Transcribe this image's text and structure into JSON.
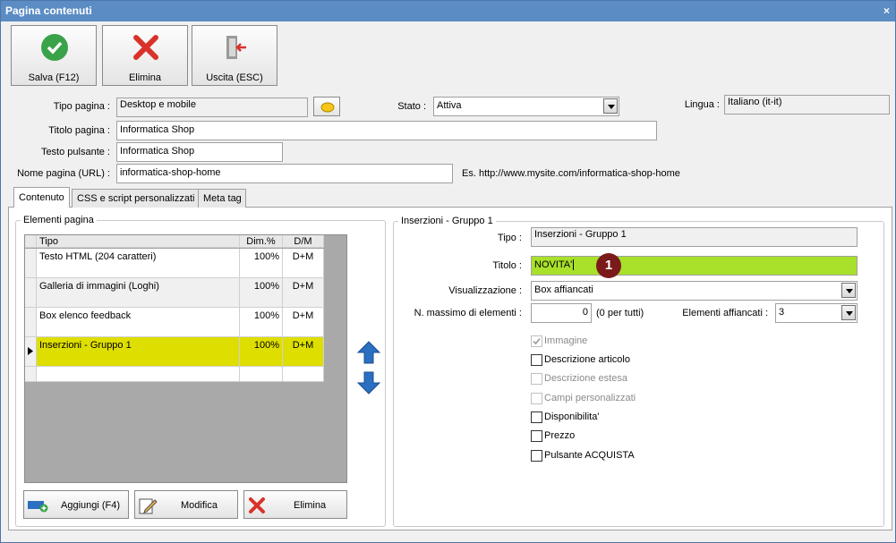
{
  "window": {
    "title": "Pagina contenuti",
    "close_glyph": "×"
  },
  "toolbar": {
    "save_label": "Salva (F12)",
    "delete_label": "Elimina",
    "exit_label": "Uscita (ESC)"
  },
  "form": {
    "tipo_label": "Tipo pagina :",
    "tipo_value": "Desktop e mobile",
    "stato_label": "Stato :",
    "stato_value": "Attiva",
    "lingua_label": "Lingua :",
    "lingua_value": "Italiano (it-it)",
    "titolo_label": "Titolo pagina :",
    "titolo_value": "Informatica Shop",
    "testo_label": "Testo pulsante :",
    "testo_value": "Informatica Shop",
    "nome_label": "Nome pagina (URL) :",
    "nome_value": "informatica-shop-home",
    "url_example": "Es. http://www.mysite.com/informatica-shop-home"
  },
  "tabs": [
    "Contenuto",
    "CSS e script personalizzati",
    "Meta tag"
  ],
  "elements_group": {
    "title": "Elementi pagina",
    "columns": [
      "Tipo",
      "Dim.%",
      "D/M"
    ],
    "rows": [
      {
        "tipo": "Testo HTML (204 caratteri)",
        "dim": "100%",
        "dm": "D+M"
      },
      {
        "tipo": "Galleria di immagini (Loghi)",
        "dim": "100%",
        "dm": "D+M"
      },
      {
        "tipo": "Box elenco feedback",
        "dim": "100%",
        "dm": "D+M"
      },
      {
        "tipo": "Inserzioni - Gruppo 1",
        "dim": "100%",
        "dm": "D+M"
      }
    ],
    "add_label": "Aggiungi (F4)",
    "edit_label": "Modifica",
    "delete_label": "Elimina"
  },
  "detail_group": {
    "title": "Inserzioni - Gruppo 1",
    "tipo_label": "Tipo :",
    "tipo_value": "Inserzioni - Gruppo 1",
    "titolo_label": "Titolo :",
    "titolo_value": "NOVITA'",
    "vis_label": "Visualizzazione :",
    "vis_value": "Box affiancati",
    "max_label": "N. massimo di elementi :",
    "max_value": "0",
    "max_hint": "(0 per tutti)",
    "affiancati_label": "Elementi affiancati :",
    "affiancati_value": "3",
    "checkboxes": [
      {
        "label": "Immagine",
        "checked": true,
        "disabled": true
      },
      {
        "label": "Descrizione articolo",
        "checked": false,
        "disabled": false
      },
      {
        "label": "Descrizione estesa",
        "checked": false,
        "disabled": true
      },
      {
        "label": "Campi personalizzati",
        "checked": false,
        "disabled": true
      },
      {
        "label": "Disponibilita'",
        "checked": false,
        "disabled": false
      },
      {
        "label": "Prezzo",
        "checked": false,
        "disabled": false
      },
      {
        "label": "Pulsante ACQUISTA",
        "checked": false,
        "disabled": false
      }
    ]
  },
  "callout": {
    "number": "1"
  },
  "colors": {
    "highlight": "#dede00",
    "titolo_bg": "#a8e02a",
    "titlebar": "#5b8cc4",
    "badge": "#7a1a1a"
  }
}
